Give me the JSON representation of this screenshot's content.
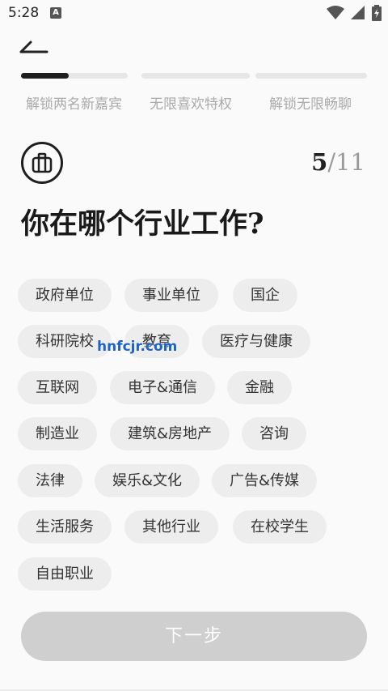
{
  "status_bar": {
    "time": "5:28",
    "notification_badge": "A",
    "icons": [
      "wifi-icon",
      "signal-icon",
      "battery-icon"
    ]
  },
  "progress": {
    "labels": [
      "解锁两名新嘉宾",
      "无限喜欢特权",
      "解锁无限畅聊"
    ],
    "fill_fraction": 0.45
  },
  "question": {
    "step_current": "5",
    "step_sep": "/",
    "step_total": "11",
    "title": "你在哪个行业工作?",
    "icon": "briefcase-icon"
  },
  "options": [
    "政府单位",
    "事业单位",
    "国企",
    "科研院校",
    "教育",
    "医疗与健康",
    "互联网",
    "电子&通信",
    "金融",
    "制造业",
    "建筑&房地产",
    "咨询",
    "法律",
    "娱乐&文化",
    "广告&传媒",
    "生活服务",
    "其他行业",
    "在校学生",
    "自由职业"
  ],
  "watermark": "hnfcjr.com",
  "next_button": "下一步",
  "colors": {
    "accent": "#1f1f1f",
    "chip_bg": "#ededed",
    "button_disabled": "#cfcfcf",
    "muted_text": "#aaaaaa"
  }
}
